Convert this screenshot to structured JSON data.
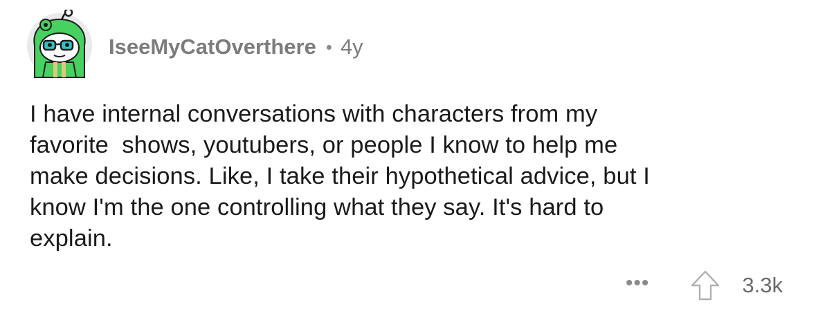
{
  "comment": {
    "avatar_icon": "snoo-frog-hat-avatar-icon",
    "username": "IseeMyCatOverthere",
    "separator": "•",
    "age": "4y",
    "body": "I have internal conversations with characters from my\nfavorite  shows, youtubers, or people I know to help me\nmake decisions. Like, I take their hypothetical advice, but I\nknow I'm the one controlling what they say. It's hard to\nexplain.",
    "actions": {
      "more_label": "•••",
      "upvote_icon": "upvote-arrow-icon",
      "score": "3.3k"
    }
  },
  "colors": {
    "text": "#1a1a1b",
    "meta": "#7c7c7f",
    "avatar_green": "#46d160",
    "avatar_bg": "#e9eaeb"
  }
}
